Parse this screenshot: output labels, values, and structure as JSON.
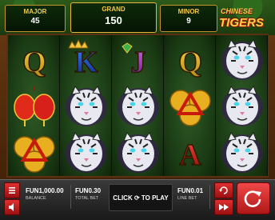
{
  "jackpots": {
    "major": {
      "label": "MAJOR",
      "value": "45"
    },
    "grand": {
      "label": "GRAND",
      "value": "150"
    },
    "minor": {
      "label": "MINOR",
      "value": "9"
    }
  },
  "logo": {
    "line1": "CHINESE",
    "line2": "TIGERS"
  },
  "reels": [
    [
      "symbol-q",
      "symbol-lantern",
      "symbol-coin-triangle"
    ],
    [
      "symbol-k",
      "symbol-white-tiger",
      "symbol-white-tiger"
    ],
    [
      "symbol-j",
      "symbol-white-tiger",
      "symbol-white-tiger"
    ],
    [
      "symbol-q",
      "symbol-coin-triangle",
      "symbol-a"
    ],
    [
      "symbol-white-tiger",
      "symbol-white-tiger",
      "symbol-white-tiger"
    ]
  ],
  "symbol_letters": {
    "q": "Q",
    "k": "K",
    "j": "J",
    "a": "A"
  },
  "bottom_bar": {
    "balance": {
      "value": "FUN1,000.00",
      "label": "BALANCE"
    },
    "total_bet": {
      "value": "FUN0.30",
      "label": "TOTAL BET"
    },
    "play_prompt": "CLICK ⟳ TO PLAY",
    "line_bet": {
      "value": "FUN0.01",
      "label": "LINE BET"
    }
  },
  "icons": {
    "menu": "menu-icon",
    "sound": "speaker-icon",
    "autoplay": "autoplay-icon",
    "fast": "fast-forward-icon",
    "spin": "spin-icon"
  }
}
